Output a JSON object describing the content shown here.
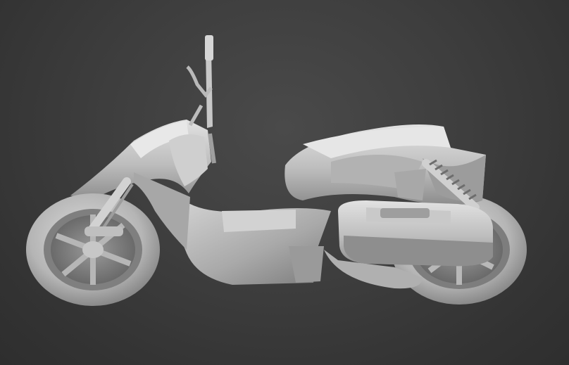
{
  "viewport": {
    "background_color": "#3e3e3e",
    "model_color": "#c8c8c8",
    "shadow_color": "#5a5a5a"
  },
  "scene": {
    "subject_icon": "scooter-model-icon",
    "render_style": "grey clay shaded 3D model"
  }
}
